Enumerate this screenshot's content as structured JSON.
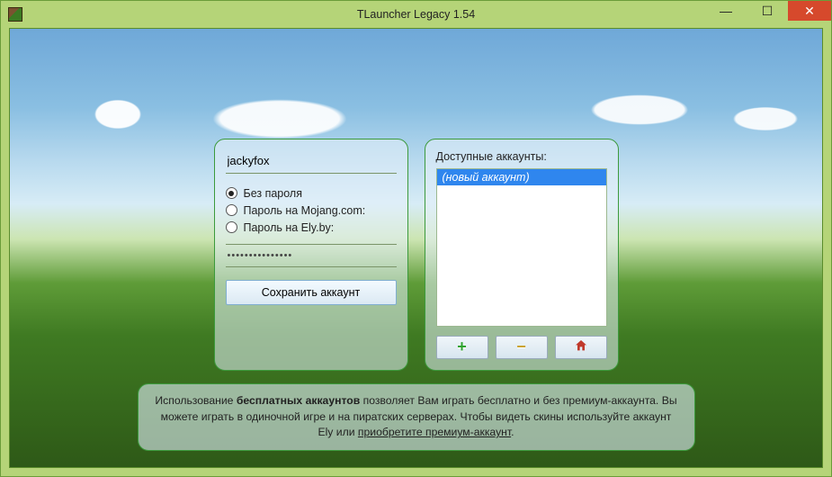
{
  "window": {
    "title": "TLauncher Legacy 1.54"
  },
  "login": {
    "username_value": "jackyfox",
    "radios": {
      "no_password": "Без пароля",
      "mojang": "Пароль на Mojang.com:",
      "ely": "Пароль на Ely.by:",
      "selected": "no_password"
    },
    "password_mask": "•••••••••••••••",
    "save_label": "Сохранить аккаунт"
  },
  "accounts": {
    "label": "Доступные аккаунты:",
    "items": [
      {
        "label": "(новый аккаунт)",
        "selected": true
      }
    ]
  },
  "info": {
    "pre": "Использование ",
    "bold": "бесплатных аккаунтов",
    "mid": " позволяет Вам играть бесплатно и без премиум-аккаунта. Вы можете играть в одиночной игре и на пиратских серверах. Чтобы видеть скины используйте аккаунт Ely или ",
    "link": "приобретите премиум-аккаунт",
    "end": "."
  },
  "colors": {
    "frame_bg": "#b5d478",
    "accent_green": "#3c9a3c",
    "selection_blue": "#2f86ee"
  }
}
